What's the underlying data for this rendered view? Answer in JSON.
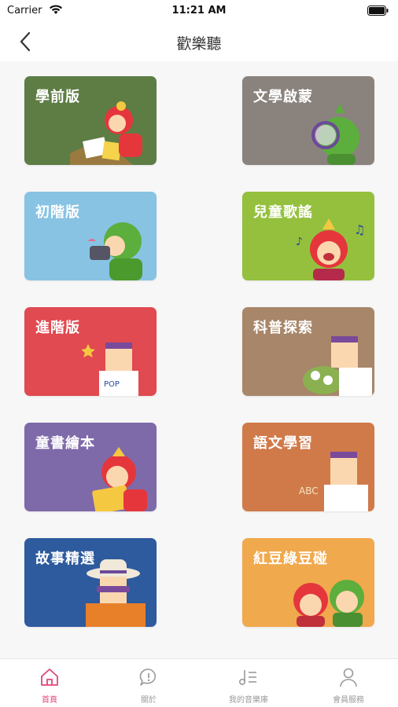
{
  "status_bar": {
    "carrier": "Carrier",
    "time": "11:21 AM"
  },
  "nav": {
    "title": "歡樂聽"
  },
  "cards": [
    {
      "label": "學前版",
      "color": "#5e7d45"
    },
    {
      "label": "文學啟蒙",
      "color": "#8a827d"
    },
    {
      "label": "初階版",
      "color": "#88c3e3"
    },
    {
      "label": "兒童歌謠",
      "color": "#94c03e"
    },
    {
      "label": "進階版",
      "color": "#e04a50"
    },
    {
      "label": "科普探索",
      "color": "#a8866a"
    },
    {
      "label": "童書繪本",
      "color": "#7e6aa9"
    },
    {
      "label": "語文學習",
      "color": "#d07a4a"
    },
    {
      "label": "故事精選",
      "color": "#2e5a9e"
    },
    {
      "label": "紅豆綠豆碰",
      "color": "#f0a94d"
    }
  ],
  "tabs": [
    {
      "label": "首頁",
      "icon": "home-icon",
      "active": true
    },
    {
      "label": "關於",
      "icon": "chat-info-icon",
      "active": false
    },
    {
      "label": "我的音樂庫",
      "icon": "music-library-icon",
      "active": false
    },
    {
      "label": "會員服務",
      "icon": "person-icon",
      "active": false
    }
  ],
  "colors": {
    "accent": "#e0457b",
    "inactive": "#9a9a9a"
  }
}
